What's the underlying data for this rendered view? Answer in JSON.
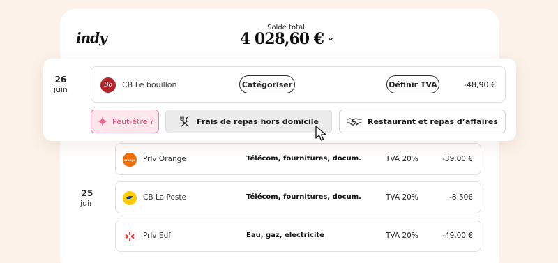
{
  "app": {
    "logo_text": "indy"
  },
  "balance": {
    "label": "Solde total",
    "value": "4 028,60 €"
  },
  "focus": {
    "date": {
      "day": "26",
      "month": "juin"
    },
    "transaction": {
      "merchant_icon": "bo-logo-icon",
      "merchant_icon_text": "Bo",
      "merchant": "CB Le bouillon",
      "categorize_label": "Catégoriser",
      "tva_label": "Définir TVA",
      "amount": "-48,90 €"
    },
    "suggestions": {
      "maybe_label": "Peut-être ?",
      "option1_label": "Frais de repas hors domicile",
      "option2_label": "Restaurant et repas d’affaires"
    }
  },
  "group": {
    "date": {
      "day": "25",
      "month": "juin"
    },
    "rows": [
      {
        "icon": "orange-logo-icon",
        "icon_text": "orange",
        "merchant": "Prlv Orange",
        "category": "Télécom, fournitures, docum.",
        "tva": "TVA 20%",
        "amount": "-39,00 €"
      },
      {
        "icon": "la-poste-logo-icon",
        "icon_text": "",
        "merchant": "CB La Poste",
        "category": "Télécom, fournitures, docum.",
        "tva": "TVA 20%",
        "amount": "-8,50€"
      },
      {
        "icon": "edf-logo-icon",
        "icon_text": "",
        "merchant": "Prlv Edf",
        "category": "Eau, gaz, électricité",
        "tva": "TVA 20%",
        "amount": "-49,00 €"
      }
    ]
  },
  "colors": {
    "background": "#fcf2e9",
    "accent_pink": "#d34a73",
    "orange": "#f16e00",
    "la_poste_yellow": "#ffcd00",
    "edf_red": "#e4362f"
  }
}
